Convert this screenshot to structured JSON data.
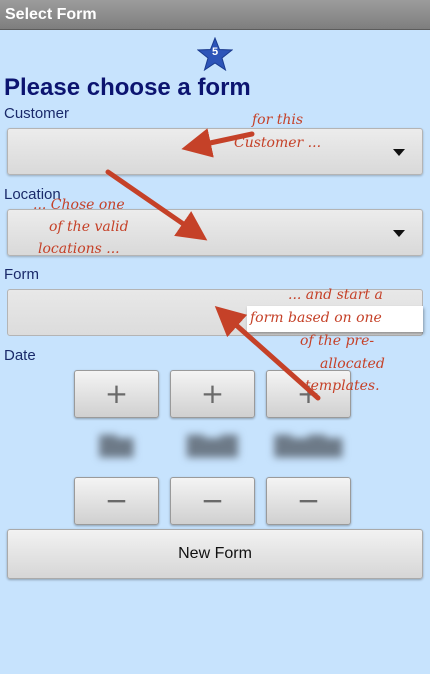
{
  "titlebar": {
    "title": "Select Form"
  },
  "badge": {
    "number": "5"
  },
  "heading": "Please choose a form",
  "fields": {
    "customer_label": "Customer",
    "location_label": "Location",
    "form_label": "Form",
    "date_label": "Date"
  },
  "date_picker": {
    "increment_symbol": "+",
    "decrement_symbol": "−"
  },
  "new_form_button": "New Form",
  "annotations": {
    "customer": [
      "for this",
      "Customer ..."
    ],
    "location": [
      "... Chose one",
      "of the valid",
      "locations ..."
    ],
    "form": [
      "... and start a",
      "form based on one",
      "of the pre-",
      "allocated",
      "templates."
    ]
  },
  "colors": {
    "background": "#c7e3fd",
    "heading": "#0c1470",
    "annotation": "#c54128",
    "badge": "#2d54b8"
  }
}
